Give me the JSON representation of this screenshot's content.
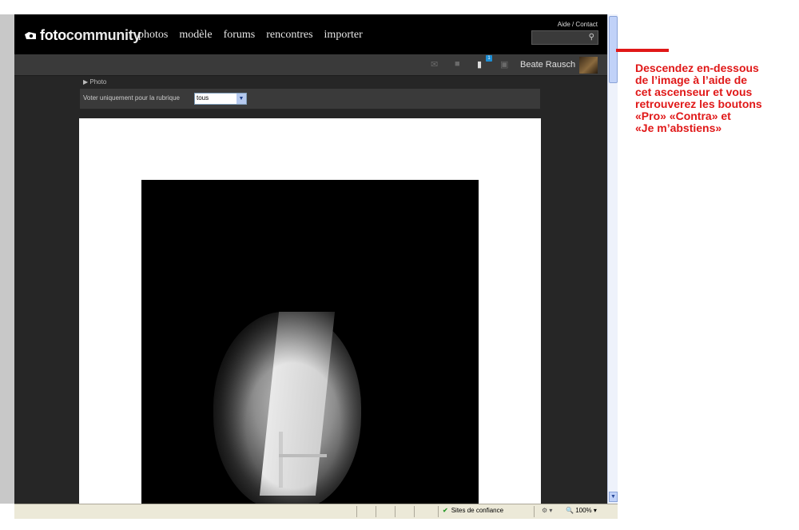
{
  "site": {
    "logo_part1": "foto",
    "logo_part2": "community",
    "nav": [
      "photos",
      "modèle",
      "forums",
      "rencontres",
      "importer"
    ],
    "help_link": "Aide / Contact",
    "search_icon": "search-icon"
  },
  "userbar": {
    "messages_count": "1",
    "username": "Beate Rausch",
    "icons": [
      "envelope-icon",
      "camera-icon",
      "comment-icon",
      "gift-icon"
    ]
  },
  "breadcrumb": "Photo",
  "filter": {
    "label": "Voter uniquement pour la rubrique",
    "selected": "tous"
  },
  "statusbar": {
    "zone": "Sites de confiance",
    "zoom": "100%"
  },
  "annotation": {
    "lines": [
      "Descendez en-dessous",
      "de l’image à l’aide de",
      "cet ascenseur et vous",
      "retrouverez les boutons",
      "«Pro» «Contra» et",
      "«Je m’abstiens»"
    ],
    "color": "#e01818"
  }
}
